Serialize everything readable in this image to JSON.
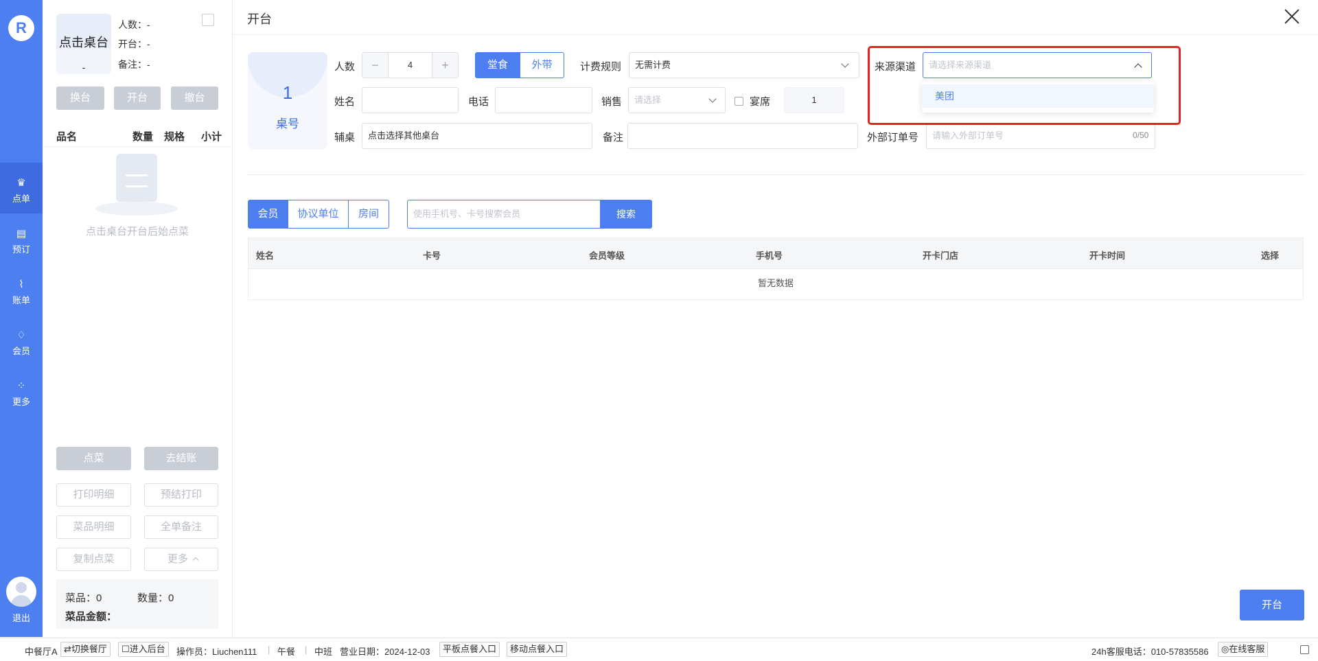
{
  "nav": {
    "logo_glyph": "R",
    "items": [
      {
        "label": "点单",
        "icon": "chef-hat-icon",
        "glyph": "♛"
      },
      {
        "label": "预订",
        "icon": "calendar-icon",
        "glyph": "▤"
      },
      {
        "label": "账单",
        "icon": "chart-icon",
        "glyph": "⌇"
      },
      {
        "label": "会员",
        "icon": "diamond-icon",
        "glyph": "♢"
      },
      {
        "label": "更多",
        "icon": "grid-icon",
        "glyph": "⁘"
      }
    ],
    "logout": "退出"
  },
  "left": {
    "table_card_title": "点击桌台",
    "table_card_value": "-",
    "people": "人数：-",
    "opened": "开台：-",
    "remark": "备注：-",
    "buttons": [
      "换台",
      "开台",
      "撤台"
    ],
    "list_headers": [
      "品名",
      "数量",
      "规格",
      "小计"
    ],
    "empty_text": "点击桌台开台后始点菜",
    "action_buttons": [
      "点菜",
      "去结账"
    ],
    "outline_buttons": [
      "打印明细",
      "预结打印",
      "菜品明细",
      "全单备注",
      "复制点菜",
      "更多"
    ],
    "dishes": "菜品：0",
    "quantity": "数量：0",
    "amount": "菜品金额："
  },
  "main": {
    "title": "开台",
    "table_number": "1",
    "table_label": "桌号",
    "labels": {
      "people": "人数",
      "fee_rule": "计费规则",
      "source": "来源渠道",
      "name": "姓名",
      "phone": "电话",
      "sales": "销售",
      "banquet": "宴席",
      "aux_table": "辅桌",
      "remark": "备注",
      "external_order": "外部订单号"
    },
    "people_value": "4",
    "dine_in": "堂食",
    "takeaway": "外带",
    "fee_rule_value": "无需计费",
    "source_placeholder": "请选择来源渠道",
    "source_option": "美团",
    "sales_placeholder": "请选择",
    "banquet_value": "1",
    "aux_table_value": "点击选择其他桌台",
    "external_order_placeholder": "请输入外部订单号",
    "external_order_counter": "0/50",
    "member_tabs": [
      "会员",
      "协议单位",
      "房间"
    ],
    "search_placeholder": "使用手机号、卡号搜索会员",
    "search_button": "搜索",
    "table_headers": [
      "姓名",
      "卡号",
      "会员等级",
      "手机号",
      "开卡门店",
      "开卡时间",
      "选择"
    ],
    "no_data": "暂无数据",
    "open_button": "开台"
  },
  "footer": {
    "hall": "中餐厅A",
    "switch_hall": "⇄切换餐厅",
    "backend": "☐进入后台",
    "operator": "操作员：Liuchen111",
    "meal": "午餐",
    "shift": "中班",
    "business_date": "营业日期：2024-12-03",
    "tablet_entry": "平板点餐入口",
    "mobile_entry": "移动点餐入口",
    "hotline": "24h客服电话：010-57835586",
    "online_service": "◎在线客服"
  },
  "colors": {
    "accent": "#4d7ff0",
    "highlight": "#e52222"
  }
}
